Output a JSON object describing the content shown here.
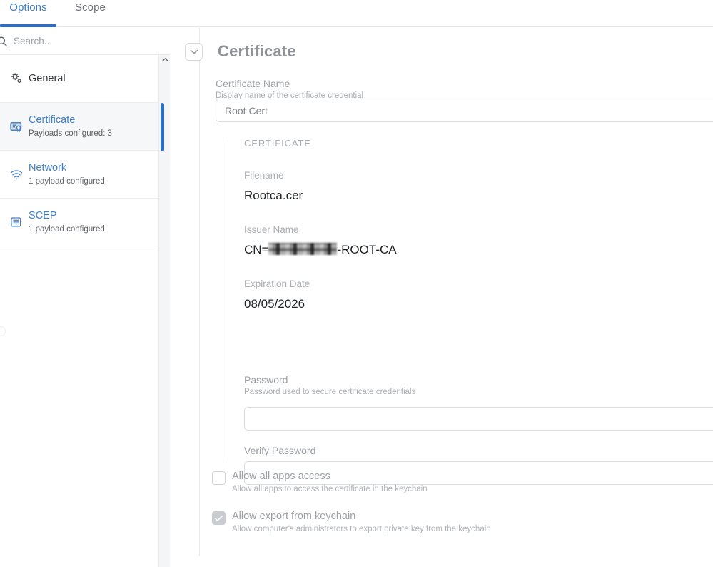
{
  "tabs": [
    {
      "id": "options",
      "label": "Options",
      "active": true
    },
    {
      "id": "scope",
      "label": "Scope",
      "active": false
    }
  ],
  "sidebar": {
    "search": {
      "placeholder": "Search...",
      "value": "",
      "icon": "search-icon"
    },
    "items": [
      {
        "icon": "gears-icon",
        "title": "General",
        "subtitle": "",
        "selected": false
      },
      {
        "icon": "certificate-card-icon",
        "title": "Certificate",
        "subtitle": "Payloads configured: 3",
        "selected": true
      },
      {
        "icon": "wifi-icon",
        "title": "Network",
        "subtitle": "1 payload configured",
        "selected": false
      },
      {
        "icon": "list-lines-icon",
        "title": "SCEP",
        "subtitle": "1 payload configured",
        "selected": false
      }
    ],
    "scrollbar": {
      "up_arrow_icon": "chevron-up-icon"
    }
  },
  "panel": {
    "collapse_icon": "chevron-down-icon",
    "title": "Certificate",
    "certificate_name": {
      "label": "Certificate Name",
      "help": "Display name of the certificate credential",
      "value": "Root Cert",
      "placeholder": ""
    },
    "certificate_details": {
      "section": "CERTIFICATE",
      "rows": [
        {
          "label": "Filename",
          "value": "Rootca.cer"
        },
        {
          "label": "Issuer Name",
          "value_prefix": "CN=",
          "value_redacted": true,
          "value_suffix": "-ROOT-CA"
        },
        {
          "label": "Expiration Date",
          "value": "08/05/2026"
        }
      ]
    },
    "password": {
      "label": "Password",
      "help": "Password used to secure certificate credentials",
      "value": "",
      "placeholder": ""
    },
    "verify_password": {
      "label": "Verify Password",
      "value": "",
      "placeholder": ""
    },
    "checkboxes": [
      {
        "id": "allow-all-apps-access",
        "title": "Allow all apps access",
        "subtitle": "Allow all apps to access the certificate in the keychain",
        "checked": false
      },
      {
        "id": "allow-export-from-keychain",
        "title": "Allow export from keychain",
        "subtitle": "Allow computer's administrators to export private key from the keychain",
        "checked": true
      }
    ]
  },
  "colors": {
    "accent": "#2f6fc2",
    "link": "#3d7ecb",
    "border": "#e3e5e8",
    "muted_text": "#9ca0a5",
    "selected_row_bg": "#f6f7f9"
  }
}
